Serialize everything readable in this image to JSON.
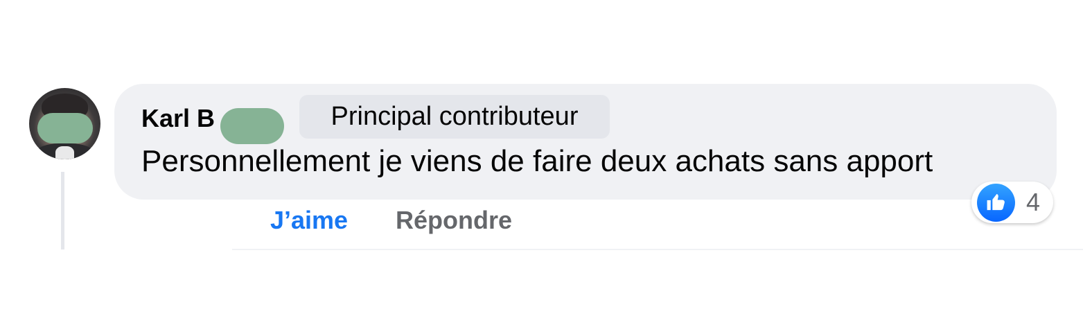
{
  "comment": {
    "author_name": "Karl B",
    "badge": "Principal contributeur",
    "text": "Personnellement je viens de faire deux achats sans apport",
    "reaction_count": "4"
  },
  "actions": {
    "like_label": "J’aime",
    "reply_label": "Répondre"
  },
  "icons": {
    "avatar": "user-photo-avatar",
    "reaction": "thumbs-up-icon"
  },
  "colors": {
    "bubble_background": "#f0f1f4",
    "badge_background": "#e4e6eb",
    "like_blue": "#1877f2",
    "muted_text": "#65676b",
    "redaction_green": "#86b395"
  }
}
